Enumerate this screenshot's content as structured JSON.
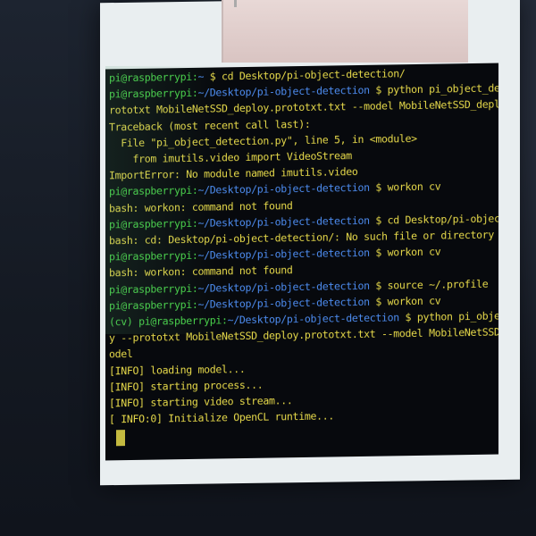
{
  "terminal": {
    "lines": [
      {
        "user": "pi@raspberrypi:",
        "path": "~ ",
        "text": "$ cd Desktop/pi-object-detection/"
      },
      {
        "user": "pi@raspberrypi:",
        "path": "~/Desktop/pi-object-detection ",
        "text": "$ python pi_object_detection.py --p"
      },
      {
        "user": "",
        "path": "",
        "text": "rototxt MobileNetSSD_deploy.prototxt.txt --model MobileNetSSD_deploy.caffemodel"
      },
      {
        "user": "",
        "path": "",
        "text": "Traceback (most recent call last):"
      },
      {
        "user": "",
        "path": "",
        "text": "  File \"pi_object_detection.py\", line 5, in <module>"
      },
      {
        "user": "",
        "path": "",
        "text": "    from imutils.video import VideoStream"
      },
      {
        "user": "",
        "path": "",
        "text": "ImportError: No module named imutils.video"
      },
      {
        "user": "pi@raspberrypi:",
        "path": "~/Desktop/pi-object-detection ",
        "text": "$ workon cv"
      },
      {
        "user": "",
        "path": "",
        "text": "bash: workon: command not found"
      },
      {
        "user": "pi@raspberrypi:",
        "path": "~/Desktop/pi-object-detection ",
        "text": "$ cd Desktop/pi-object-detection/"
      },
      {
        "user": "",
        "path": "",
        "text": "bash: cd: Desktop/pi-object-detection/: No such file or directory"
      },
      {
        "user": "pi@raspberrypi:",
        "path": "~/Desktop/pi-object-detection ",
        "text": "$ workon cv"
      },
      {
        "user": "",
        "path": "",
        "text": "bash: workon: command not found"
      },
      {
        "user": "pi@raspberrypi:",
        "path": "~/Desktop/pi-object-detection ",
        "text": "$ source ~/.profile"
      },
      {
        "user": "pi@raspberrypi:",
        "path": "~/Desktop/pi-object-detection ",
        "text": "$ workon cv"
      },
      {
        "user": "(cv) pi@raspberrypi:",
        "path": "~/Desktop/pi-object-detection ",
        "text": "$ python pi_object_detection.p"
      },
      {
        "user": "",
        "path": "",
        "text": "y --prototxt MobileNetSSD_deploy.prototxt.txt --model MobileNetSSD_deploy.caffem"
      },
      {
        "user": "",
        "path": "",
        "text": "odel"
      },
      {
        "user": "",
        "path": "",
        "text": "[INFO] loading model..."
      },
      {
        "user": "",
        "path": "",
        "text": "[INFO] starting process..."
      },
      {
        "user": "",
        "path": "",
        "text": "[INFO] starting video stream..."
      },
      {
        "user": "",
        "path": "",
        "text": "[ INFO:0] Initialize OpenCL runtime..."
      }
    ]
  },
  "colors": {
    "prompt_user": "#49d24a",
    "prompt_path": "#4d8cf0",
    "output_text": "#e6d94a",
    "terminal_bg": "#07090d"
  }
}
